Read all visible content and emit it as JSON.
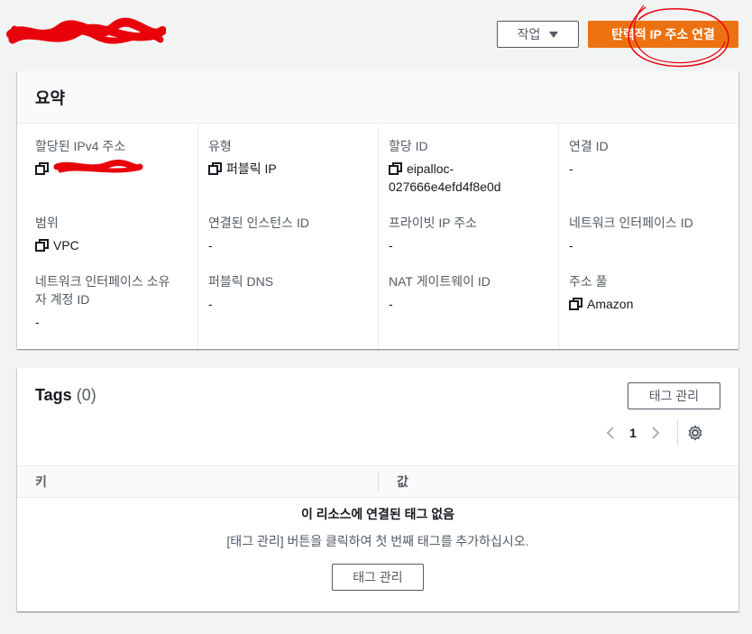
{
  "header": {
    "actions_label": "작업",
    "primary_label": "탄력적 IP 주소 연결"
  },
  "summary": {
    "title": "요약",
    "fields": {
      "ipv4": {
        "label": "할당된 IPv4 주소"
      },
      "type": {
        "label": "유형",
        "value": "퍼블릭 IP"
      },
      "alloc_id": {
        "label": "할당 ID",
        "value_line1": "eipalloc-",
        "value_line2": "027666e4efd4f8e0d"
      },
      "assoc_id": {
        "label": "연결 ID",
        "value": "-"
      },
      "scope": {
        "label": "범위",
        "value": "VPC"
      },
      "instance_id": {
        "label": "연결된 인스턴스 ID",
        "value": "-"
      },
      "private_ip": {
        "label": "프라이빗 IP 주소",
        "value": "-"
      },
      "eni_id": {
        "label": "네트워크 인터페이스 ID",
        "value": "-"
      },
      "eni_owner": {
        "label_line1": "네트워크 인터페이스 소유",
        "label_line2": "자 계정 ID",
        "value": "-"
      },
      "public_dns": {
        "label": "퍼블릭 DNS",
        "value": "-"
      },
      "nat_gw": {
        "label": "NAT 게이트웨이 ID",
        "value": "-"
      },
      "pool": {
        "label": "주소 풀",
        "value": "Amazon"
      }
    }
  },
  "tags": {
    "title": "Tags",
    "count": "(0)",
    "manage_label": "태그 관리",
    "page": "1",
    "columns": [
      "키",
      "값"
    ],
    "empty_title": "이 리소스에 연결된 태그 없음",
    "empty_desc": "[태그 관리] 버튼을 클릭하여 첫 번째 태그를 추가하십시오.",
    "empty_button": "태그 관리"
  },
  "colors": {
    "primary": "#ec7211",
    "redaction": "#e8000b"
  },
  "icons": [
    "copy-icon",
    "caret-down-icon",
    "chevron-left-icon",
    "chevron-right-icon",
    "gear-icon"
  ]
}
